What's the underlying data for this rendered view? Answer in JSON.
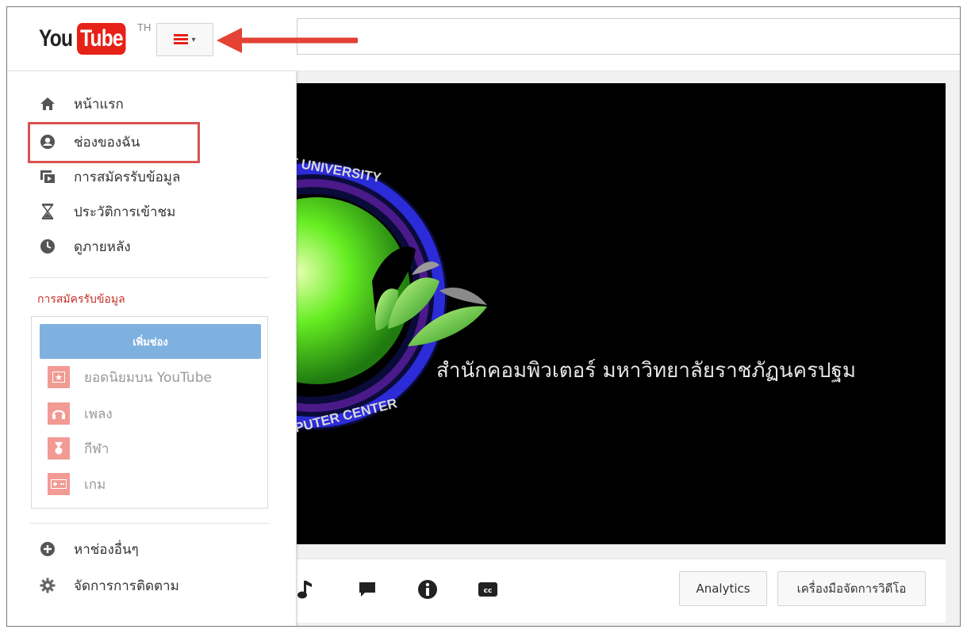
{
  "header": {
    "logo_you": "You",
    "logo_tube": "Tube",
    "region": "TH"
  },
  "guide": {
    "nav": [
      {
        "label": "หน้าแรก",
        "icon": "home-icon"
      },
      {
        "label": "ช่องของฉัน",
        "icon": "account-icon"
      },
      {
        "label": "การสมัครรับข้อมูล",
        "icon": "subscriptions-icon"
      },
      {
        "label": "ประวัติการเข้าชม",
        "icon": "hourglass-icon"
      },
      {
        "label": "ดูภายหลัง",
        "icon": "clock-icon"
      }
    ],
    "subscriptions_title": "การสมัครรับข้อมูล",
    "add_channel_label": "เพิ่มช่อง",
    "channels": [
      {
        "label": "ยอดนิยมบน YouTube",
        "icon": "star-icon"
      },
      {
        "label": "เพลง",
        "icon": "headphones-icon"
      },
      {
        "label": "กีฬา",
        "icon": "medal-icon"
      },
      {
        "label": "เกม",
        "icon": "gamepad-icon"
      }
    ],
    "footer": [
      {
        "label": "หาช่องอื่นๆ",
        "icon": "plus-circle-icon"
      },
      {
        "label": "จัดการการติดตาม",
        "icon": "gear-icon"
      }
    ]
  },
  "player": {
    "caption": "สำนักคอมพิวเตอร์ มหาวิทยาลัยราชภัฏนครปฐม",
    "logo_text_top": "T UNIVERSITY",
    "logo_text_bottom": "PUTER CENTER"
  },
  "actions": {
    "analytics_label": "Analytics",
    "video_manager_label": "เครื่องมือจัดการวิดีโอ"
  },
  "colors": {
    "brand_red": "#e62117",
    "highlight": "#d9534f",
    "add_button": "#7fb1e0",
    "tile": "#f29a94"
  }
}
